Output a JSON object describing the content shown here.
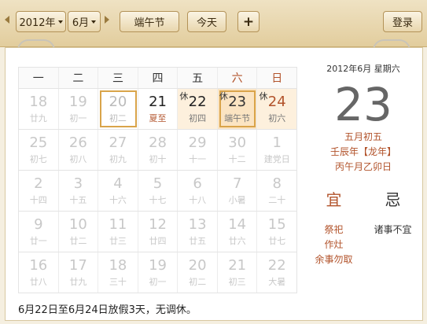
{
  "toolbar": {
    "year_select": "2012年",
    "month_select": "6月",
    "holiday_select": "端午节",
    "today_button": "今天",
    "add_button": "+",
    "login_button": "登录"
  },
  "weekdays": [
    "一",
    "二",
    "三",
    "四",
    "五",
    "六",
    "日"
  ],
  "weeks": [
    [
      {
        "num": "18",
        "sub": "廿九",
        "dimmed": true
      },
      {
        "num": "19",
        "sub": "初一",
        "dimmed": true
      },
      {
        "num": "20",
        "sub": "初二",
        "today": true
      },
      {
        "num": "21",
        "sub": "夏至",
        "cur": true,
        "subterm": true
      },
      {
        "num": "22",
        "sub": "初四",
        "cur": true,
        "rest": "休",
        "holiday": true
      },
      {
        "num": "23",
        "sub": "端午节",
        "cur": true,
        "rest": "休",
        "holiday": true,
        "selected": true
      },
      {
        "num": "24",
        "sub": "初六",
        "cur": true,
        "rest": "休",
        "holiday": true,
        "weekend": true
      }
    ],
    [
      {
        "num": "25",
        "sub": "初七",
        "dimmed": true
      },
      {
        "num": "26",
        "sub": "初八",
        "dimmed": true
      },
      {
        "num": "27",
        "sub": "初九",
        "dimmed": true
      },
      {
        "num": "28",
        "sub": "初十",
        "dimmed": true
      },
      {
        "num": "29",
        "sub": "十一",
        "dimmed": true
      },
      {
        "num": "30",
        "sub": "十二",
        "dimmed": true
      },
      {
        "num": "1",
        "sub": "建党日",
        "dimmed": true
      }
    ],
    [
      {
        "num": "2",
        "sub": "十四",
        "dimmed": true
      },
      {
        "num": "3",
        "sub": "十五",
        "dimmed": true
      },
      {
        "num": "4",
        "sub": "十六",
        "dimmed": true
      },
      {
        "num": "5",
        "sub": "十七",
        "dimmed": true
      },
      {
        "num": "6",
        "sub": "十八",
        "dimmed": true
      },
      {
        "num": "7",
        "sub": "小暑",
        "dimmed": true,
        "subterm": true
      },
      {
        "num": "8",
        "sub": "二十",
        "dimmed": true
      }
    ],
    [
      {
        "num": "9",
        "sub": "廿一",
        "dimmed": true
      },
      {
        "num": "10",
        "sub": "廿二",
        "dimmed": true
      },
      {
        "num": "11",
        "sub": "廿三",
        "dimmed": true
      },
      {
        "num": "12",
        "sub": "廿四",
        "dimmed": true
      },
      {
        "num": "13",
        "sub": "廿五",
        "dimmed": true
      },
      {
        "num": "14",
        "sub": "廿六",
        "dimmed": true
      },
      {
        "num": "15",
        "sub": "廿七",
        "dimmed": true
      }
    ],
    [
      {
        "num": "16",
        "sub": "廿八",
        "dimmed": true
      },
      {
        "num": "17",
        "sub": "廿九",
        "dimmed": true
      },
      {
        "num": "18",
        "sub": "三十",
        "dimmed": true
      },
      {
        "num": "19",
        "sub": "初一",
        "dimmed": true
      },
      {
        "num": "20",
        "sub": "初二",
        "dimmed": true
      },
      {
        "num": "21",
        "sub": "初三",
        "dimmed": true
      },
      {
        "num": "22",
        "sub": "大暑",
        "dimmed": true,
        "subterm": true
      }
    ]
  ],
  "note": "6月22日至6月24日放假3天，无调休。",
  "side": {
    "date_line": "2012年6月  星期六",
    "big_day": "23",
    "lunar_date": "五月初五",
    "year_ganzhi": "壬辰年【龙年】",
    "month_day_ganzhi": "丙午月乙卯日",
    "yi_title": "宜",
    "ji_title": "忌",
    "yi_items": [
      "祭祀",
      "作灶",
      "余事勿取"
    ],
    "ji_items": [
      "诸事不宜"
    ]
  },
  "colors": {
    "accent": "#b2532b",
    "highlight_border": "#d9a44a",
    "holiday_bg": "#fdf0dd"
  }
}
